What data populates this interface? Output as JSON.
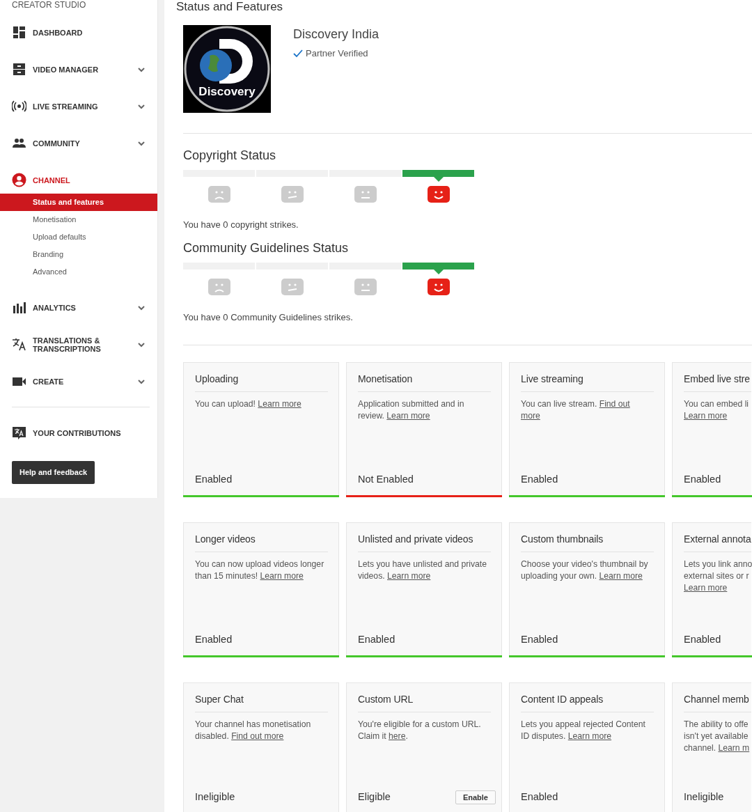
{
  "sidebar": {
    "heading": "CREATOR STUDIO",
    "items": [
      {
        "kind": "dashboard",
        "label": "DASHBOARD",
        "expandable": false,
        "selected": false
      },
      {
        "kind": "video-manager",
        "label": "VIDEO MANAGER",
        "expandable": true,
        "selected": false
      },
      {
        "kind": "live",
        "label": "LIVE STREAMING",
        "expandable": true,
        "selected": false
      },
      {
        "kind": "community",
        "label": "COMMUNITY",
        "expandable": true,
        "selected": false
      },
      {
        "kind": "channel",
        "label": "CHANNEL",
        "expandable": false,
        "selected": true,
        "children": [
          {
            "label": "Status and features",
            "selected": true
          },
          {
            "label": "Monetisation",
            "selected": false
          },
          {
            "label": "Upload defaults",
            "selected": false
          },
          {
            "label": "Branding",
            "selected": false
          },
          {
            "label": "Advanced",
            "selected": false
          }
        ]
      },
      {
        "kind": "analytics",
        "label": "ANALYTICS",
        "expandable": true,
        "selected": false
      },
      {
        "kind": "translate",
        "label": "TRANSLATIONS & TRANSCRIPTIONS",
        "expandable": true,
        "selected": false
      },
      {
        "kind": "create",
        "label": "CREATE",
        "expandable": true,
        "selected": false
      }
    ],
    "contributions": "YOUR CONTRIBUTIONS",
    "help_button": "Help and feedback"
  },
  "page_title": "Status and Features",
  "channel": {
    "name": "Discovery India",
    "logo_text": "Discovery",
    "verified": true,
    "verified_label": "Partner Verified"
  },
  "strike_sections": [
    {
      "title": "Copyright Status",
      "segments": [
        {
          "kind": "sad",
          "selected": false
        },
        {
          "kind": "meh",
          "selected": false
        },
        {
          "kind": "neutral",
          "selected": false
        },
        {
          "kind": "happy",
          "selected": true
        }
      ],
      "summary": "You have 0 copyright strikes."
    },
    {
      "title": "Community Guidelines Status",
      "segments": [
        {
          "kind": "sad",
          "selected": false
        },
        {
          "kind": "meh",
          "selected": false
        },
        {
          "kind": "neutral",
          "selected": false
        },
        {
          "kind": "happy",
          "selected": true
        }
      ],
      "summary": "You have 0 Community Guidelines strikes."
    }
  ],
  "features": [
    {
      "title": "Uploading",
      "description": [
        [
          {
            "text": "You can upload! "
          },
          {
            "link": "Learn more"
          }
        ]
      ],
      "status": "Enabled",
      "kind": "enabled"
    },
    {
      "title": "Monetisation",
      "description": [
        [
          {
            "text": "Application submitted and in"
          }
        ],
        [
          {
            "text": "review. "
          },
          {
            "link": "Learn more"
          }
        ]
      ],
      "status": "Not Enabled",
      "kind": "disabled"
    },
    {
      "title": "Live streaming",
      "description": [
        [
          {
            "text": "You can live stream. "
          },
          {
            "link": "Find out"
          }
        ],
        [
          {
            "link": "more"
          }
        ]
      ],
      "status": "Enabled",
      "kind": "enabled"
    },
    {
      "title": "Embed live stre",
      "description": [
        [
          {
            "text": "You can embed li"
          }
        ],
        [
          {
            "link": "Learn more"
          }
        ]
      ],
      "status": "Enabled",
      "kind": "enabled"
    },
    {
      "title": "Longer videos",
      "description": [
        [
          {
            "text": "You can now upload videos longer"
          }
        ],
        [
          {
            "text": "than 15 minutes! "
          },
          {
            "link": "Learn more"
          }
        ]
      ],
      "status": "Enabled",
      "kind": "enabled"
    },
    {
      "title": "Unlisted and private videos",
      "description": [
        [
          {
            "text": "Lets you have unlisted and private"
          }
        ],
        [
          {
            "text": "videos. "
          },
          {
            "link": "Learn more"
          }
        ]
      ],
      "status": "Enabled",
      "kind": "enabled"
    },
    {
      "title": "Custom thumbnails",
      "description": [
        [
          {
            "text": "Choose your video's thumbnail by"
          }
        ],
        [
          {
            "text": "uploading your own. "
          },
          {
            "link": "Learn more"
          }
        ]
      ],
      "status": "Enabled",
      "kind": "enabled"
    },
    {
      "title": "External annota",
      "description": [
        [
          {
            "text": "Lets you link anno"
          }
        ],
        [
          {
            "text": "external sites or r"
          }
        ],
        [
          {
            "link": "Learn more"
          }
        ]
      ],
      "status": "Enabled",
      "kind": "enabled"
    },
    {
      "title": "Super Chat",
      "description": [
        [
          {
            "text": "Your channel has monetisation"
          }
        ],
        [
          {
            "text": "disabled. "
          },
          {
            "link": "Find out more"
          }
        ]
      ],
      "status": "Ineligible"
    },
    {
      "title": "Custom URL",
      "description": [
        [
          {
            "text": "You're eligible for a custom URL."
          }
        ],
        [
          {
            "text": "Claim it "
          },
          {
            "link": "here"
          },
          {
            "text": "."
          }
        ]
      ],
      "status": "Eligible",
      "button": "Enable"
    },
    {
      "title": "Content ID appeals",
      "description": [
        [
          {
            "text": "Lets you appeal rejected Content"
          }
        ],
        [
          {
            "text": "ID disputes. "
          },
          {
            "link": "Learn more"
          }
        ]
      ],
      "status": "Enabled"
    },
    {
      "title": "Channel memb",
      "description": [
        [
          {
            "text": "The ability to offe"
          }
        ],
        [
          {
            "text": "isn't yet available"
          }
        ],
        [
          {
            "text": "channel. "
          },
          {
            "link": "Learn m"
          }
        ]
      ],
      "status": "Ineligible"
    }
  ]
}
